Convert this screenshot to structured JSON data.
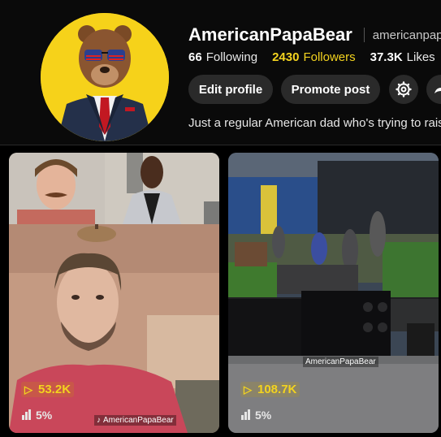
{
  "profile": {
    "display_name": "AmericanPapaBear",
    "handle": "americanpapa",
    "following_count": "66",
    "following_label": "Following",
    "followers_count": "2430",
    "followers_label": "Followers",
    "likes_count": "37.3K",
    "likes_label": "Likes",
    "bio": "Just a regular American dad who's trying to rais"
  },
  "actions": {
    "edit_profile": "Edit profile",
    "promote_post": "Promote post",
    "settings_icon": "gear-icon",
    "share_icon": "share-icon"
  },
  "videos": [
    {
      "views": "53.2K",
      "percent": "5%",
      "watermark": "AmericanPapaBear"
    },
    {
      "views": "108.7K",
      "percent": "5%",
      "watermark": "AmericanPapaBear"
    }
  ],
  "colors": {
    "background": "#000000",
    "accent_yellow": "#f3d31f",
    "button_bg": "#2a2a2a",
    "avatar_bg": "#f6d21a"
  }
}
